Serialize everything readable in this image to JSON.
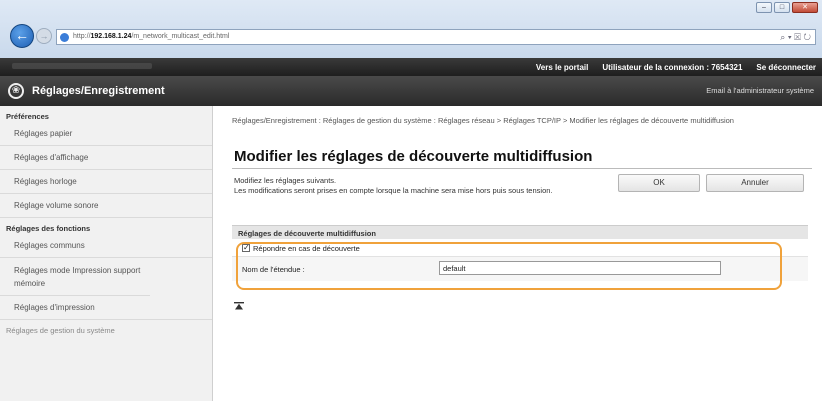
{
  "browser": {
    "url_prefix": "http://",
    "url_host": "192.168.1.24",
    "url_path": "/m_network_multicast_edit.html",
    "addr_tools": "⌕ ▾ ☒ ↻",
    "window_controls": {
      "minimize": "–",
      "maximize": "□",
      "close": "✕"
    },
    "back": "←",
    "forward": "→"
  },
  "topbar": {
    "portal_link": "Vers le portail",
    "login_user_label": "Utilisateur de la connexion :",
    "login_user_value": "7654321",
    "logout_link": "Se déconnecter"
  },
  "header": {
    "title": "Réglages/Enregistrement",
    "admin_email_link": "Email à l'administrateur système",
    "icon": "❀"
  },
  "sidebar": {
    "section1": "Préférences",
    "items1": [
      "Réglages papier",
      "Réglages d'affichage",
      "Réglages horloge",
      "Réglage volume sonore"
    ],
    "section2": "Réglages des fonctions",
    "items2": [
      "Réglages communs",
      "Réglages mode Impression support mémoire",
      "Réglages d'impression"
    ],
    "section3": "Réglages de gestion du système"
  },
  "main": {
    "breadcrumb": "Réglages/Enregistrement : Réglages de gestion du système : Réglages réseau > Réglages TCP/IP > Modifier les réglages de découverte multidiffusion",
    "title": "Modifier les réglages de découverte multidiffusion",
    "desc_line1": "Modifiez les réglages suivants.",
    "desc_line2": "Les modifications seront prises en compte lorsque la machine sera mise hors puis sous tension.",
    "ok_label": "OK",
    "cancel_label": "Annuler",
    "section_title": "Réglages de découverte multidiffusion",
    "checkbox_label": "Répondre en cas de découverte",
    "checkbox_mark": "✓",
    "scope_label": "Nom de l'étendue :",
    "scope_value": "default"
  },
  "colors": {
    "highlight": "#f0a23b",
    "topbar": "#1e1e1e",
    "sidebar_bg": "#f1f1f1"
  }
}
